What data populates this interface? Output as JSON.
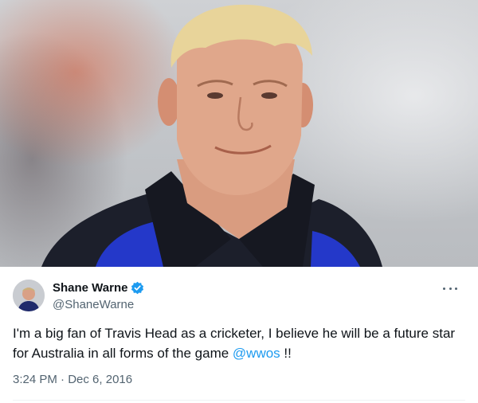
{
  "photo": {
    "subject": "man-portrait"
  },
  "tweet": {
    "author": {
      "display_name": "Shane Warne",
      "handle": "@ShaneWarne",
      "verified": true
    },
    "text_prefix": "I'm a big fan of Travis Head as a cricketer, I believe he will be a future star for Australia in all forms of the game ",
    "mention": "@wwos",
    "text_suffix": " !!",
    "time": "3:24 PM",
    "separator": " · ",
    "date": "Dec 6, 2016"
  },
  "icons": {
    "verified": "verified-badge-icon",
    "more": "more-options-icon"
  },
  "colors": {
    "accent": "#1d9bf0",
    "text": "#0f1419",
    "muted": "#536471"
  }
}
